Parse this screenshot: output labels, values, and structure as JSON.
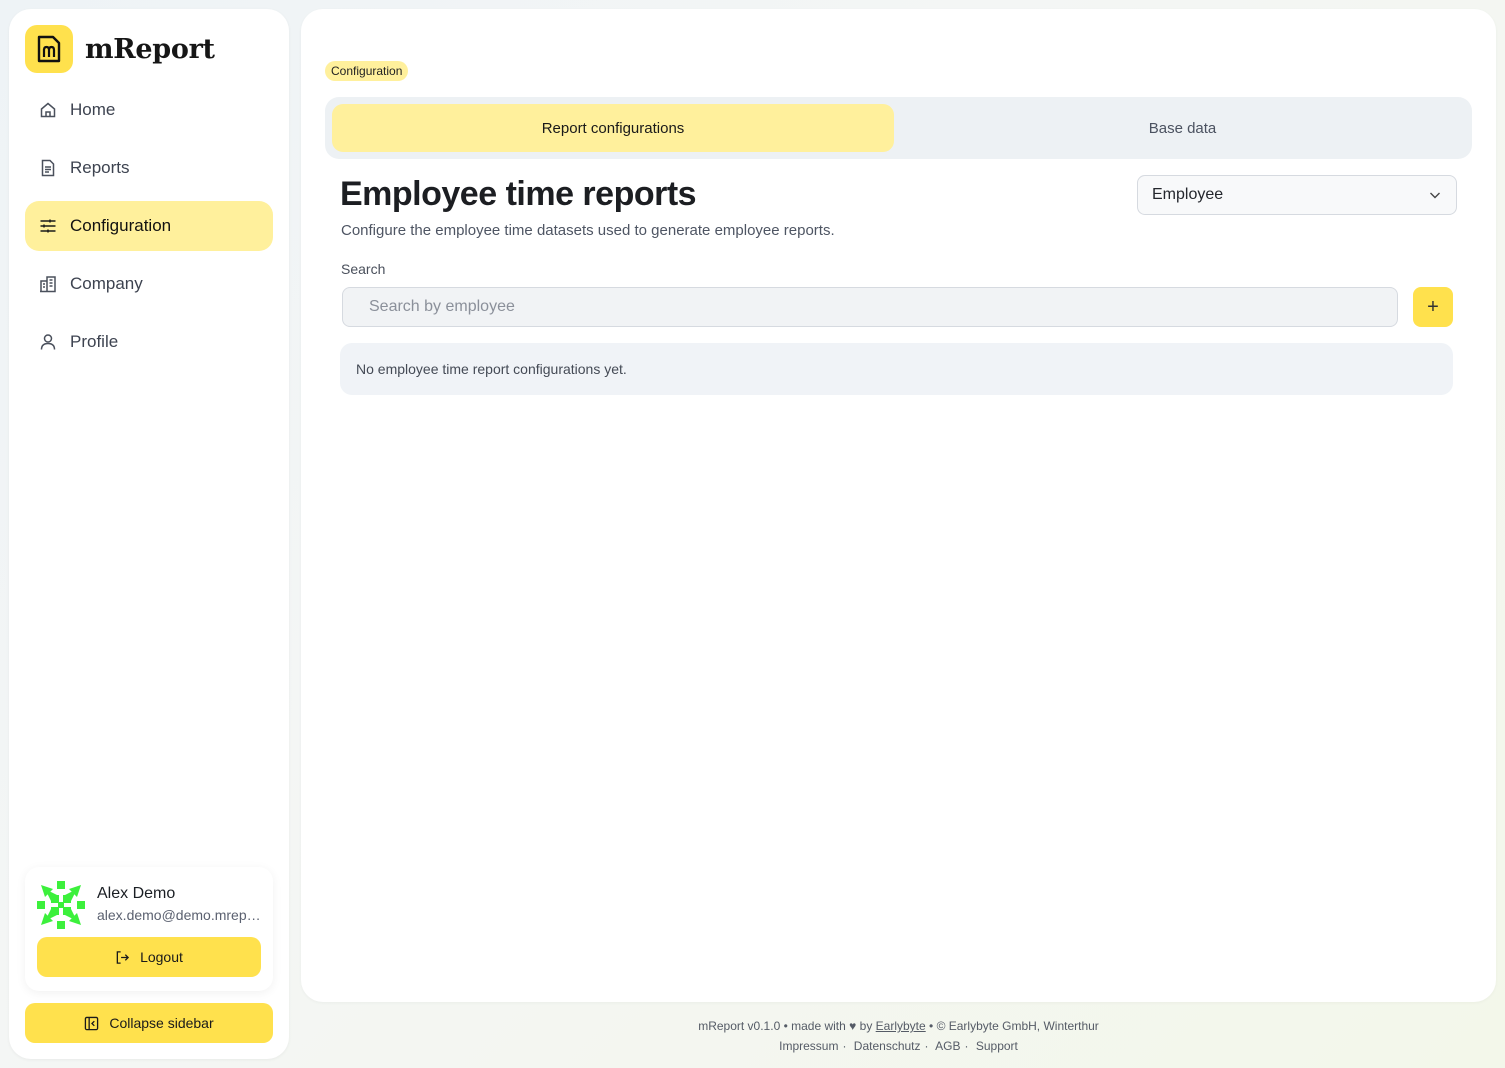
{
  "brand": {
    "name": "mReport"
  },
  "nav": [
    {
      "label": "Home",
      "icon": "home-icon"
    },
    {
      "label": "Reports",
      "icon": "document-icon"
    },
    {
      "label": "Configuration",
      "icon": "sliders-icon",
      "active": true
    },
    {
      "label": "Company",
      "icon": "building-icon"
    },
    {
      "label": "Profile",
      "icon": "user-icon"
    }
  ],
  "user": {
    "name": "Alex Demo",
    "email": "alex.demo@demo.mreport.ch"
  },
  "buttons": {
    "logout": "Logout",
    "collapse": "Collapse sidebar",
    "add": "+"
  },
  "breadcrumb": "Configuration",
  "tabs": [
    "Report configurations",
    "Base data"
  ],
  "page": {
    "title": "Employee time reports",
    "subtitle": "Configure the employee time datasets used to generate employee reports."
  },
  "filter": {
    "selected": "Employee"
  },
  "search": {
    "label": "Search",
    "placeholder": "Search by employee"
  },
  "empty_state": "No employee time report configurations yet.",
  "footer": {
    "version": "mReport v0.1.0",
    "made_with": "made with",
    "by": "by",
    "company_link": "Earlybyte",
    "copyright": "© Earlybyte GmbH, Winterthur",
    "links": [
      "Impressum",
      "Datenschutz",
      "AGB",
      "Support"
    ]
  },
  "colors": {
    "accent": "#ffe14d",
    "accent_soft": "#fff09c",
    "avatar": "#3cf03c"
  }
}
